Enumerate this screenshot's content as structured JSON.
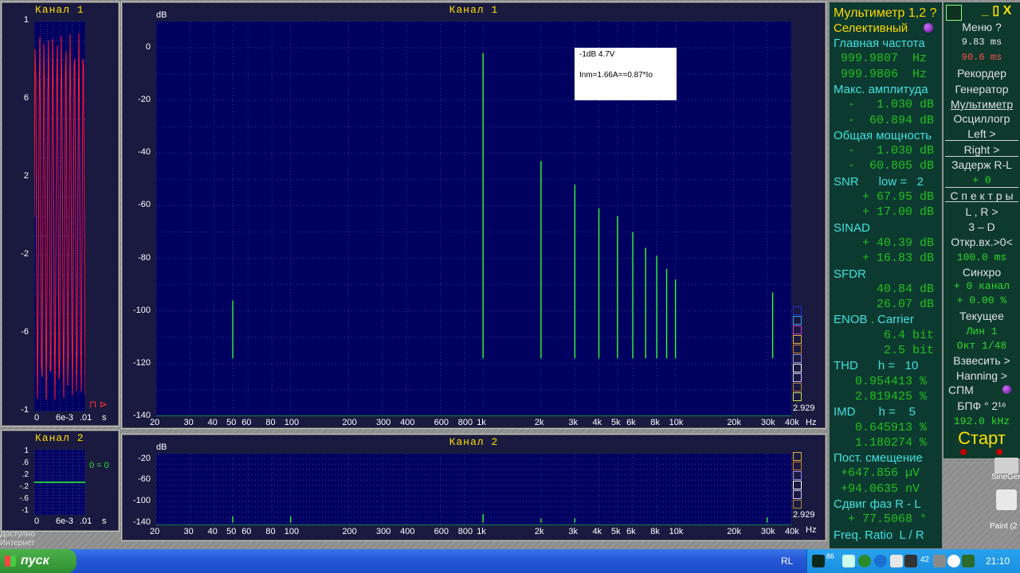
{
  "channel1": {
    "title": "Канал 1",
    "y_unit": "dB",
    "y_ticks": [
      "0",
      "-20",
      "-40",
      "-60",
      "-80",
      "-100",
      "-120",
      "-140"
    ],
    "x_ticks": [
      "20",
      "30",
      "40",
      "50",
      "60",
      "80",
      "100",
      "200",
      "300",
      "400",
      "600",
      "800",
      "1k",
      "2k",
      "3k",
      "4k",
      "5k",
      "6k",
      "8k",
      "10k",
      "20k",
      "30k",
      "40k"
    ],
    "x_unit": "Hz",
    "corner_value": "2.929",
    "annotation": {
      "line1": "-1dB  4.7V",
      "line2": "Inm=1.66A==0.87*Io"
    }
  },
  "channel2": {
    "title": "Канал 2",
    "y_unit": "dB",
    "y_ticks": [
      "-20",
      "-60",
      "-100",
      "-140"
    ],
    "x_ticks": [
      "20",
      "30",
      "40",
      "50",
      "60",
      "80",
      "100",
      "200",
      "300",
      "400",
      "600",
      "800",
      "1k",
      "2k",
      "3k",
      "4k",
      "5k",
      "6k",
      "8k",
      "10k",
      "20k",
      "30k",
      "40k"
    ],
    "x_unit": "Hz",
    "corner_value": "2.929"
  },
  "osc1": {
    "title": "Канал 1",
    "y_ticks": [
      "1",
      "6",
      "2",
      "-2",
      "-6",
      "-1"
    ],
    "x_ticks": [
      "0",
      "6e-3",
      ".01",
      "s"
    ],
    "marker": "⊓ ⊳"
  },
  "osc2": {
    "title": "Канал 2",
    "y_ticks": [
      "1",
      ".6",
      ".2",
      "-.2",
      "-.6",
      "-1"
    ],
    "x_ticks": [
      "0",
      "6e-3",
      ".01",
      "s"
    ],
    "zero_label": "0 = 0"
  },
  "multimeter": {
    "title": "Мультиметр 1,2 ?",
    "mode": "Селективный",
    "rows": [
      {
        "t": "Главная частота",
        "c": "cyan"
      },
      {
        "t": " 999.9807  Hz",
        "c": "grn"
      },
      {
        "t": " 999.9806  Hz",
        "c": "grn"
      },
      {
        "t": "Макс. амплитуда",
        "c": "cyan"
      },
      {
        "t": "  -   1.030 dB",
        "c": "grn"
      },
      {
        "t": "  -  60.894 dB",
        "c": "grn"
      },
      {
        "t": "Общая мощность",
        "c": "cyan"
      },
      {
        "t": "  -   1.030 dB",
        "c": "grn"
      },
      {
        "t": "  -  60.805 dB",
        "c": "grn"
      },
      {
        "t": "SNR      low =   2",
        "c": "cyan"
      },
      {
        "t": "    + 67.95 dB",
        "c": "grn"
      },
      {
        "t": "    + 17.00 dB",
        "c": "grn"
      },
      {
        "t": "SINAD",
        "c": "cyan"
      },
      {
        "t": "    + 40.39 dB",
        "c": "grn"
      },
      {
        "t": "    + 16.83 dB",
        "c": "grn"
      },
      {
        "t": "SFDR",
        "c": "cyan"
      },
      {
        "t": "      40.84 dB",
        "c": "grn"
      },
      {
        "t": "      26.07 dB",
        "c": "grn"
      },
      {
        "t": "ENOB . Carrier",
        "c": "cyan"
      },
      {
        "t": "       6.4 bit",
        "c": "grn"
      },
      {
        "t": "       2.5 bit",
        "c": "grn"
      },
      {
        "t": "THD      h =   10",
        "c": "cyan"
      },
      {
        "t": "   0.954413 %",
        "c": "grn"
      },
      {
        "t": "   2.819425 %",
        "c": "grn"
      },
      {
        "t": "IMD       h =    5",
        "c": "cyan"
      },
      {
        "t": "   0.645913 %",
        "c": "grn"
      },
      {
        "t": "   1.180274 %",
        "c": "grn"
      },
      {
        "t": "Пост. смещение",
        "c": "cyan"
      },
      {
        "t": " +647.856 µV",
        "c": "grn"
      },
      {
        "t": " +94.0635 nV",
        "c": "grn"
      },
      {
        "t": "Сдвиг фаз R - L",
        "c": "cyan"
      },
      {
        "t": "  + 77.5068 °",
        "c": "grn"
      },
      {
        "t": "Freq. Ratio  L / R",
        "c": "cyan"
      }
    ]
  },
  "menu": {
    "title_right": "_ ▯ X",
    "items": [
      "Меню        ?",
      "9.83 ms",
      "90.6 ms",
      "Рекордер",
      "Генератор",
      "Мультиметр",
      "Осциллогр",
      "Left        >",
      "Right      >",
      "Задерж  R-L",
      "+          0",
      "С п е к т р ы",
      "L , R       >",
      "3 – D",
      "Откр.вх.>0<",
      "100.0 ms",
      "Синхро",
      "+  0 канал",
      "+  0.00 %",
      "Текущее",
      "Лин         1",
      "Окт   1/48",
      "Взвесить  >",
      "Hanning   >",
      "СПМ",
      "БПФ ° 2¹⁶",
      "192.0 kHz",
      "Старт"
    ]
  },
  "desktop": {
    "icon1": "SineGen",
    "icon2": "Paint (2",
    "left_text1": "Доступно",
    "left_text2": "Интернет"
  },
  "taskbar": {
    "start_label": "пуск",
    "lang": "RL",
    "tray_count": "86",
    "tray_num": "42",
    "clock": "21:10"
  }
}
